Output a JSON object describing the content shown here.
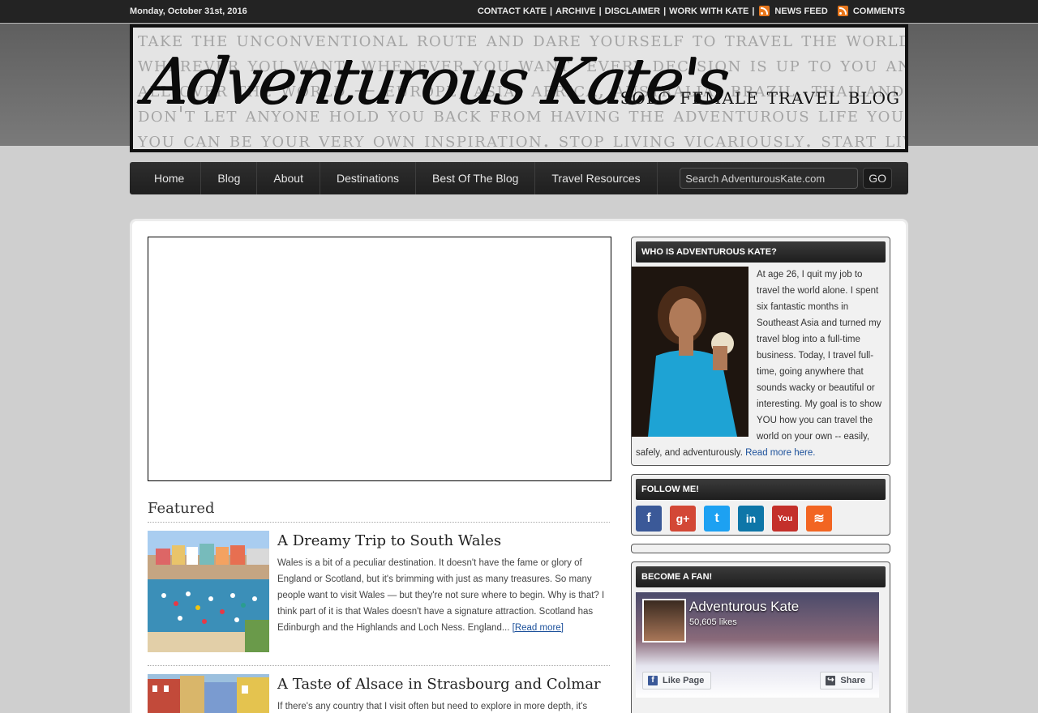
{
  "topbar": {
    "date": "Monday, October 31st, 2016",
    "links": [
      "CONTACT KATE",
      "ARCHIVE",
      "DISCLAIMER",
      "WORK WITH KATE"
    ],
    "news_feed": "NEWS FEED",
    "comments": "COMMENTS"
  },
  "header": {
    "bg_lines": [
      "take the unconventional route and dare yourself to travel the world on your own.",
      "wherever you want. whenever you want. every decision is up to you and you alone!",
      "all over the world — europe, asia, africa, australia, brazil, thailand, japan!",
      "don't let anyone hold you back from having the adventurous life you want to live!",
      "you can be your very own inspiration. stop living vicariously. start living your life."
    ],
    "logo": "Adventurous Kate's",
    "tagline": "solo female travel blog"
  },
  "nav": {
    "items": [
      "Home",
      "Blog",
      "About",
      "Destinations",
      "Best Of The Blog",
      "Travel Resources"
    ],
    "search_placeholder": "Search AdventurousKate.com",
    "go_label": "GO"
  },
  "main": {
    "featured_heading": "Featured",
    "posts": [
      {
        "title": "A Dreamy Trip to South Wales",
        "excerpt": "Wales is a bit of a peculiar destination. It doesn't have the fame or glory of England or Scotland, but it's brimming with just as many treasures. So many people want to visit Wales — but they're not sure where to begin. Why is that? I think part of it is that Wales doesn't have a signature attraction. Scotland has Edinburgh and the Highlands and Loch Ness. England...",
        "read_more": "[Read more]"
      },
      {
        "title": "A Taste of Alsace in Strasbourg and Colmar",
        "excerpt": "If there's any country that I visit often but need to explore in more depth, it's"
      }
    ]
  },
  "sidebar": {
    "about": {
      "title": "WHO IS ADVENTUROUS KATE?",
      "text": "At age 26, I quit my job to travel the world alone. I spent six fantastic months in Southeast Asia and turned my travel blog into a full-time business. Today, I travel full-time, going anywhere that sounds wacky or beautiful or interesting. My goal is to show YOU how you can travel the world on your own -- easily, safely, and adventurously. ",
      "link": "Read more here."
    },
    "follow": {
      "title": "FOLLOW ME!",
      "icons": [
        {
          "name": "facebook-icon",
          "glyph": "f",
          "color": "#3b5998"
        },
        {
          "name": "google-plus-icon",
          "glyph": "g+",
          "color": "#d34836"
        },
        {
          "name": "twitter-icon",
          "glyph": "t",
          "color": "#1da1f2"
        },
        {
          "name": "linkedin-icon",
          "glyph": "in",
          "color": "#0e76a8"
        },
        {
          "name": "youtube-icon",
          "glyph": "You",
          "color": "#c4302b"
        },
        {
          "name": "rss-icon",
          "glyph": "≋",
          "color": "#f26522"
        }
      ]
    },
    "fan": {
      "title": "BECOME A FAN!",
      "page_name": "Adventurous Kate",
      "likes": "50,605 likes",
      "like_btn": "Like Page",
      "share_btn": "Share"
    }
  }
}
